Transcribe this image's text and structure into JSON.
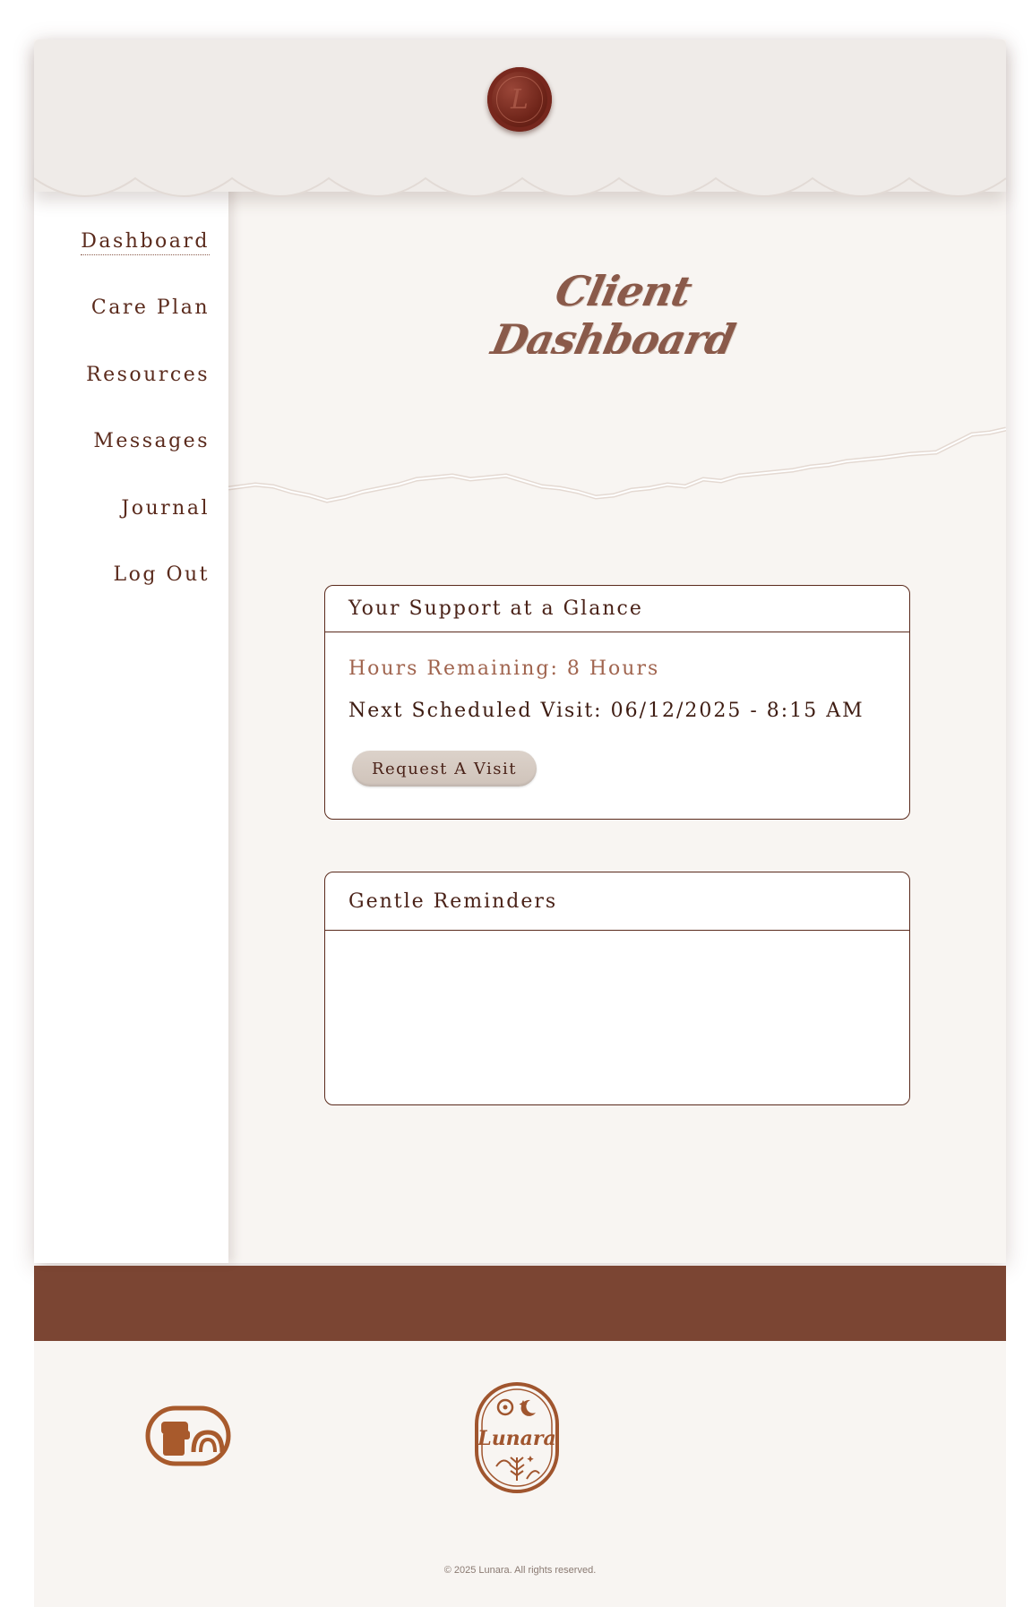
{
  "header": {
    "seal_letter": "L"
  },
  "sidebar": {
    "items": [
      {
        "label": "Dashboard",
        "active": true
      },
      {
        "label": "Care Plan"
      },
      {
        "label": "Resources"
      },
      {
        "label": "Messages"
      },
      {
        "label": "Journal"
      },
      {
        "label": "Log Out"
      }
    ]
  },
  "main": {
    "title": "Client Dashboard",
    "support_card": {
      "title": "Your Support at a Glance",
      "hours_remaining": "Hours Remaining: 8 Hours",
      "next_visit": "Next Scheduled Visit: 06/12/2025 - 8:15 AM",
      "request_button": "Request A Visit"
    },
    "reminders_card": {
      "title": "Gentle Reminders"
    }
  },
  "footer": {
    "logo_text": "Lunara",
    "copyright": "© 2025 Lunara. All rights reserved."
  },
  "colors": {
    "accent_brown": "#7b4533",
    "text_dark": "#5a2a1c",
    "paper": "#f8f5f2",
    "seal": "#6e2419"
  }
}
